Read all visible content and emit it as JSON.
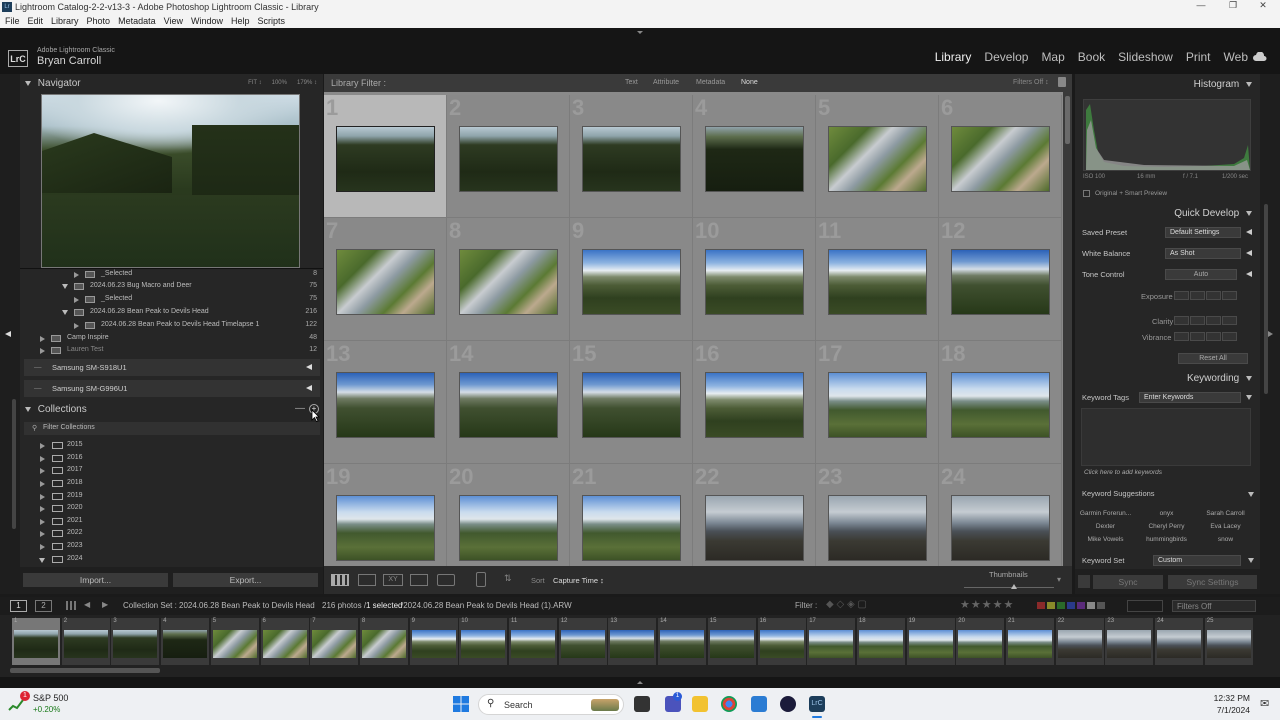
{
  "window": {
    "title": "Lightroom Catalog-2-2-v13-3 - Adobe Photoshop Lightroom Classic - Library"
  },
  "menu": [
    "File",
    "Edit",
    "Library",
    "Photo",
    "Metadata",
    "View",
    "Window",
    "Help",
    "Scripts"
  ],
  "identity": {
    "badge": "LrC",
    "app_name": "Adobe Lightroom Classic",
    "user": "Bryan Carroll"
  },
  "modules": [
    "Library",
    "Develop",
    "Map",
    "Book",
    "Slideshow",
    "Print",
    "Web"
  ],
  "active_module": "Library",
  "navigator": {
    "title": "Navigator",
    "zoom_options": [
      "FIT ↕",
      "100%",
      "179% ↕"
    ]
  },
  "folders": [
    {
      "name": "_Selected",
      "count": "8"
    },
    {
      "name": "2024.06.23 Bug Macro and Deer",
      "count": "75"
    },
    {
      "name": "_Selected",
      "count": "75"
    },
    {
      "name": "2024.06.28 Bean Peak to Devils Head",
      "count": "216"
    },
    {
      "name": "2024.06.28 Bean Peak to Devils Head Timelapse 1",
      "count": "122"
    },
    {
      "name": "Camp Inspire",
      "count": "48"
    },
    {
      "name": "Lauren Test",
      "count": "12"
    }
  ],
  "drives": [
    "Samsung SM-S918U1",
    "Samsung SM-G996U1"
  ],
  "collections": {
    "title": "Collections",
    "filter_label": "Filter Collections",
    "sets": [
      "2015",
      "2016",
      "2017",
      "2018",
      "2019",
      "2020",
      "2021",
      "2022",
      "2023",
      "2024"
    ]
  },
  "left_buttons": {
    "import": "Import...",
    "export": "Export..."
  },
  "library_filter": {
    "label": "Library Filter :",
    "options": [
      "Text",
      "Attribute",
      "Metadata",
      "None"
    ],
    "filters_off": "Filters Off ↕"
  },
  "grid": {
    "selected_index": 0,
    "cells": [
      {
        "n": "1",
        "t": "t-forest"
      },
      {
        "n": "2",
        "t": "t-forest"
      },
      {
        "n": "3",
        "t": "t-forest"
      },
      {
        "n": "4",
        "t": "t-forest-d"
      },
      {
        "n": "5",
        "t": "t-creek"
      },
      {
        "n": "6",
        "t": "t-creek"
      },
      {
        "n": "7",
        "t": "t-creek"
      },
      {
        "n": "8",
        "t": "t-creek"
      },
      {
        "n": "9",
        "t": "t-mtn"
      },
      {
        "n": "10",
        "t": "t-mtn"
      },
      {
        "n": "11",
        "t": "t-mtn"
      },
      {
        "n": "12",
        "t": "t-mtn2"
      },
      {
        "n": "13",
        "t": "t-mtn2"
      },
      {
        "n": "14",
        "t": "t-mtn2"
      },
      {
        "n": "15",
        "t": "t-mtn2"
      },
      {
        "n": "16",
        "t": "t-mtn"
      },
      {
        "n": "17",
        "t": "t-valley"
      },
      {
        "n": "18",
        "t": "t-valley"
      },
      {
        "n": "19",
        "t": "t-valley"
      },
      {
        "n": "20",
        "t": "t-valley"
      },
      {
        "n": "21",
        "t": "t-valley"
      },
      {
        "n": "22",
        "t": "t-cloud"
      },
      {
        "n": "23",
        "t": "t-cloud"
      },
      {
        "n": "24",
        "t": "t-cloud"
      }
    ]
  },
  "toolbar": {
    "sort_label": "Sort",
    "sort_value": "Capture Time ↕",
    "thumbnails_label": "Thumbnails"
  },
  "histogram": {
    "title": "Histogram",
    "iso": "ISO 100",
    "focal": "16 mm",
    "aperture": "f / 7.1",
    "shutter": "1/200 sec",
    "preview": "Original + Smart Preview"
  },
  "quick_develop": {
    "title": "Quick Develop",
    "saved_preset_label": "Saved Preset",
    "saved_preset_value": "Default Settings",
    "white_balance_label": "White Balance",
    "white_balance_value": "As Shot",
    "tone_control_label": "Tone Control",
    "auto_label": "Auto",
    "exposure_label": "Exposure",
    "clarity_label": "Clarity",
    "vibrance_label": "Vibrance",
    "reset_all": "Reset All"
  },
  "keywording": {
    "title": "Keywording",
    "tags_label": "Keyword Tags",
    "tags_value": "Enter Keywords",
    "add_hint": "Click here to add keywords",
    "suggestions_label": "Keyword Suggestions",
    "suggestions": [
      "Garmin Forerun...",
      "onyx",
      "Sarah Carroll",
      "Dexter",
      "Cheryl Perry",
      "Eva Lacey",
      "Mike Vowels",
      "hummingbirds",
      "snow"
    ],
    "set_label": "Keyword Set",
    "set_value": "Custom"
  },
  "right_buttons": {
    "sync": "Sync",
    "sync_settings": "Sync Settings"
  },
  "status": {
    "page1": "1",
    "page2": "2",
    "source": "Collection Set : 2024.06.28 Bean Peak to Devils Head",
    "photos_prefix": "216 photos /",
    "selected": "1 selected",
    "file": "/2024.06.28 Bean Peak to Devils Head (1).ARW",
    "filter_label": "Filter :",
    "filters_off": "Filters Off"
  },
  "filmstrip": {
    "selected_index": 0,
    "cells": [
      {
        "n": "1",
        "t": "t-forest"
      },
      {
        "n": "2",
        "t": "t-forest"
      },
      {
        "n": "3",
        "t": "t-forest"
      },
      {
        "n": "4",
        "t": "t-forest-d"
      },
      {
        "n": "5",
        "t": "t-creek"
      },
      {
        "n": "6",
        "t": "t-creek"
      },
      {
        "n": "7",
        "t": "t-creek"
      },
      {
        "n": "8",
        "t": "t-creek"
      },
      {
        "n": "9",
        "t": "t-mtn"
      },
      {
        "n": "10",
        "t": "t-mtn"
      },
      {
        "n": "11",
        "t": "t-mtn"
      },
      {
        "n": "12",
        "t": "t-mtn2"
      },
      {
        "n": "13",
        "t": "t-mtn2"
      },
      {
        "n": "14",
        "t": "t-mtn2"
      },
      {
        "n": "15",
        "t": "t-mtn2"
      },
      {
        "n": "16",
        "t": "t-mtn"
      },
      {
        "n": "17",
        "t": "t-valley"
      },
      {
        "n": "18",
        "t": "t-valley"
      },
      {
        "n": "19",
        "t": "t-valley"
      },
      {
        "n": "20",
        "t": "t-valley"
      },
      {
        "n": "21",
        "t": "t-valley"
      },
      {
        "n": "22",
        "t": "t-cloud"
      },
      {
        "n": "23",
        "t": "t-cloud"
      },
      {
        "n": "24",
        "t": "t-cloud"
      },
      {
        "n": "25",
        "t": "t-cloud"
      }
    ]
  },
  "taskbar": {
    "stock_name": "S&P 500",
    "stock_change": "+0.20%",
    "search_placeholder": "Search",
    "time": "12:32 PM",
    "date": "7/1/2024",
    "teams_badge": "1"
  }
}
